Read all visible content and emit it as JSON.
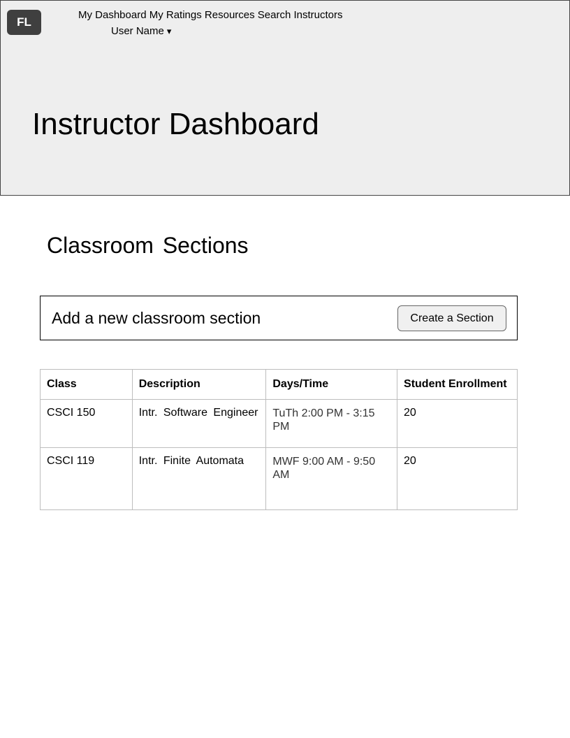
{
  "header": {
    "logo": "FL",
    "nav": [
      {
        "label": "My Dashboard"
      },
      {
        "label": "My Ratings"
      },
      {
        "label": "Resources"
      },
      {
        "label": "Search Instructors"
      }
    ],
    "user_name": "User Name",
    "user_caret_icon": "caret-down-icon"
  },
  "hero": {
    "title": "Instructor Dashboard"
  },
  "sections": {
    "title": "Classroom Sections",
    "add_label": "Add a new classroom section",
    "create_button": "Create a Section",
    "table": {
      "headers": [
        "Class",
        "Description",
        "Days/Time",
        "Student Enrollment"
      ],
      "rows": [
        [
          "CSCI 150",
          "Intr. Software Engineer",
          "TuTh 2:00 PM - 3:15 PM",
          "20"
        ],
        [
          "CSCI 119",
          "Intr. Finite Automata",
          "MWF 9:00 AM - 9:50 AM",
          "20"
        ]
      ]
    }
  },
  "colors": {
    "header_bg": "#eeeeee",
    "logo_bg": "#3f3f3f",
    "button_bg": "#f0f0f0"
  }
}
